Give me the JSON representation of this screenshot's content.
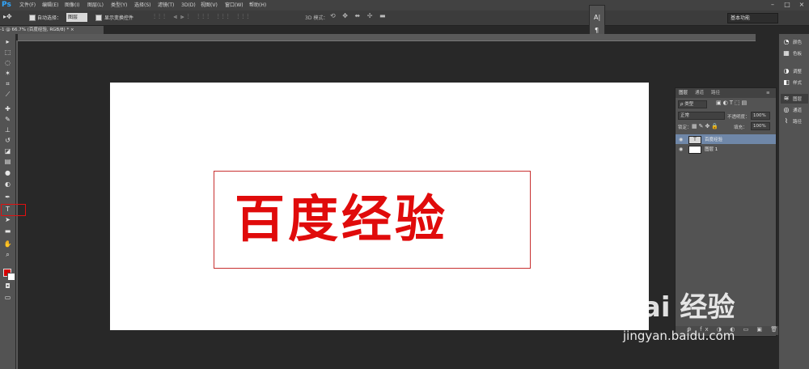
{
  "app": {
    "logo": "Ps"
  },
  "menu": [
    "文件(F)",
    "编辑(E)",
    "图像(I)",
    "图层(L)",
    "类型(Y)",
    "选择(S)",
    "滤镜(T)",
    "3D(D)",
    "视图(V)",
    "窗口(W)",
    "帮助(H)"
  ],
  "options_bar": {
    "auto_select_label": "自动选择：",
    "auto_select_value": "图层",
    "show_transform_label": "显示变换控件",
    "mode_3d_label": "3D 模式：",
    "workspace": "基本功能"
  },
  "document_tab": {
    "title": "-1 @ 66.7% (百度经验, RGB/8) *",
    "close": "×"
  },
  "canvas": {
    "text": "百度经验",
    "text_color": "#e00b0b"
  },
  "mini_panel": {
    "top_glyph": "A|",
    "bottom_glyph": "¶"
  },
  "layers_panel": {
    "tabs": [
      "图层",
      "通道",
      "路径"
    ],
    "filter_kind": "ρ 类型",
    "blend_mode": "正常",
    "opacity_label": "不透明度：",
    "opacity_value": "100%",
    "lock_label": "锁定：",
    "fill_label": "填充：",
    "fill_value": "100%",
    "layers": [
      {
        "name": "百度经验",
        "thumb": "T",
        "selected": true
      },
      {
        "name": "图层 1",
        "thumb": "",
        "selected": false
      }
    ]
  },
  "right_dock": [
    {
      "icon": "history-icon",
      "glyph": "◔",
      "label": "颜色"
    },
    {
      "icon": "swatches-icon",
      "glyph": "▦",
      "label": "色板"
    },
    {
      "icon": "adjustments-icon",
      "glyph": "◑",
      "label": "调整"
    },
    {
      "icon": "styles-icon",
      "glyph": "◧",
      "label": "样式"
    },
    {
      "icon": "layers-icon",
      "glyph": "≋",
      "label": "图层"
    },
    {
      "icon": "channels-icon",
      "glyph": "◎",
      "label": "通道"
    },
    {
      "icon": "paths-icon",
      "glyph": "⌇",
      "label": "路径"
    }
  ],
  "watermark": {
    "main": "Bai 经验",
    "url": "jingyan.baidu.com"
  },
  "colors": {
    "foreground": "#d40000",
    "background": "#ffffff",
    "highlight": "#e01010"
  }
}
